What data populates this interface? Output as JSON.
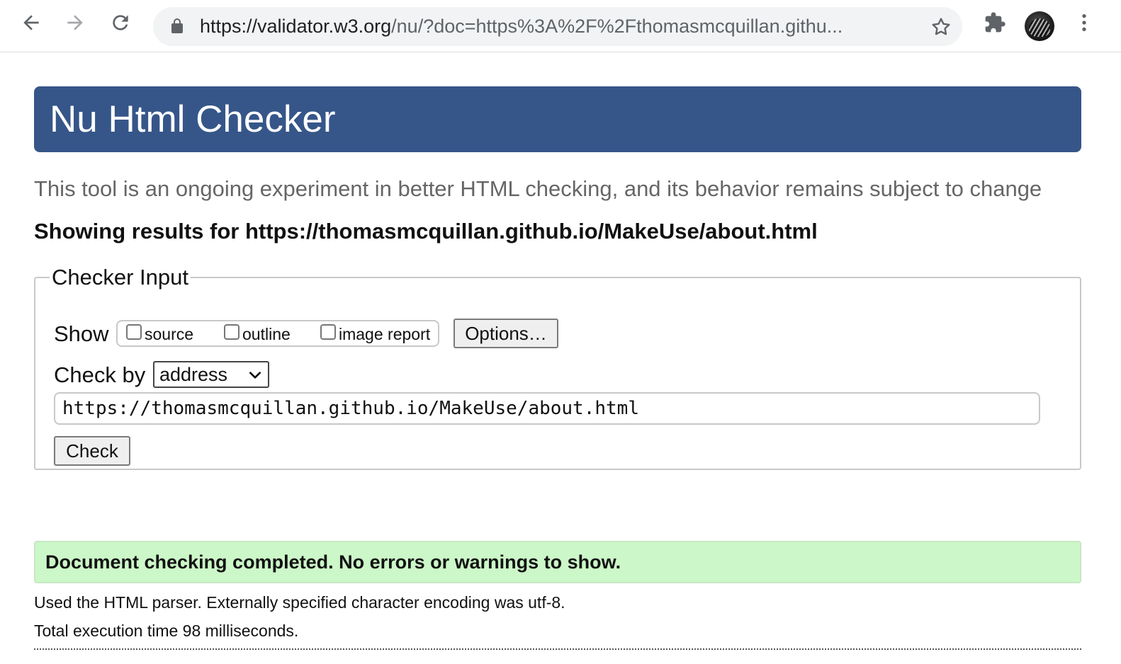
{
  "browser": {
    "url_host": "https://validator.w3.org",
    "url_rest": "/nu/?doc=https%3A%2F%2Fthomasmcquillan.githu..."
  },
  "icons": {
    "back": "arrow-left-icon",
    "forward": "arrow-right-icon",
    "reload": "reload-icon",
    "lock": "lock-icon",
    "star": "star-icon",
    "extensions": "puzzle-icon",
    "menu": "kebab-menu-icon",
    "select": "chevron-down-icon"
  },
  "colors": {
    "banner": "#365689",
    "success": "#ccf7c8"
  },
  "page": {
    "title": "Nu Html Checker",
    "subtitle": "This tool is an ongoing experiment in better HTML checking, and its behavior remains subject to change",
    "showing_results": "Showing results for https://thomasmcquillan.github.io/MakeUse/about.html"
  },
  "checker": {
    "legend": "Checker Input",
    "show_label": "Show",
    "options": [
      {
        "label": "source",
        "checked": false
      },
      {
        "label": "outline",
        "checked": false
      },
      {
        "label": "image report",
        "checked": false
      }
    ],
    "options_button": "Options…",
    "check_by_label": "Check by",
    "check_by_value": "address",
    "url_value": "https://thomasmcquillan.github.io/MakeUse/about.html",
    "check_button": "Check"
  },
  "results": {
    "success_message": "Document checking completed. No errors or warnings to show.",
    "parser_info": "Used the HTML parser. Externally specified character encoding was utf-8.",
    "execution_time": "Total execution time 98 milliseconds."
  }
}
